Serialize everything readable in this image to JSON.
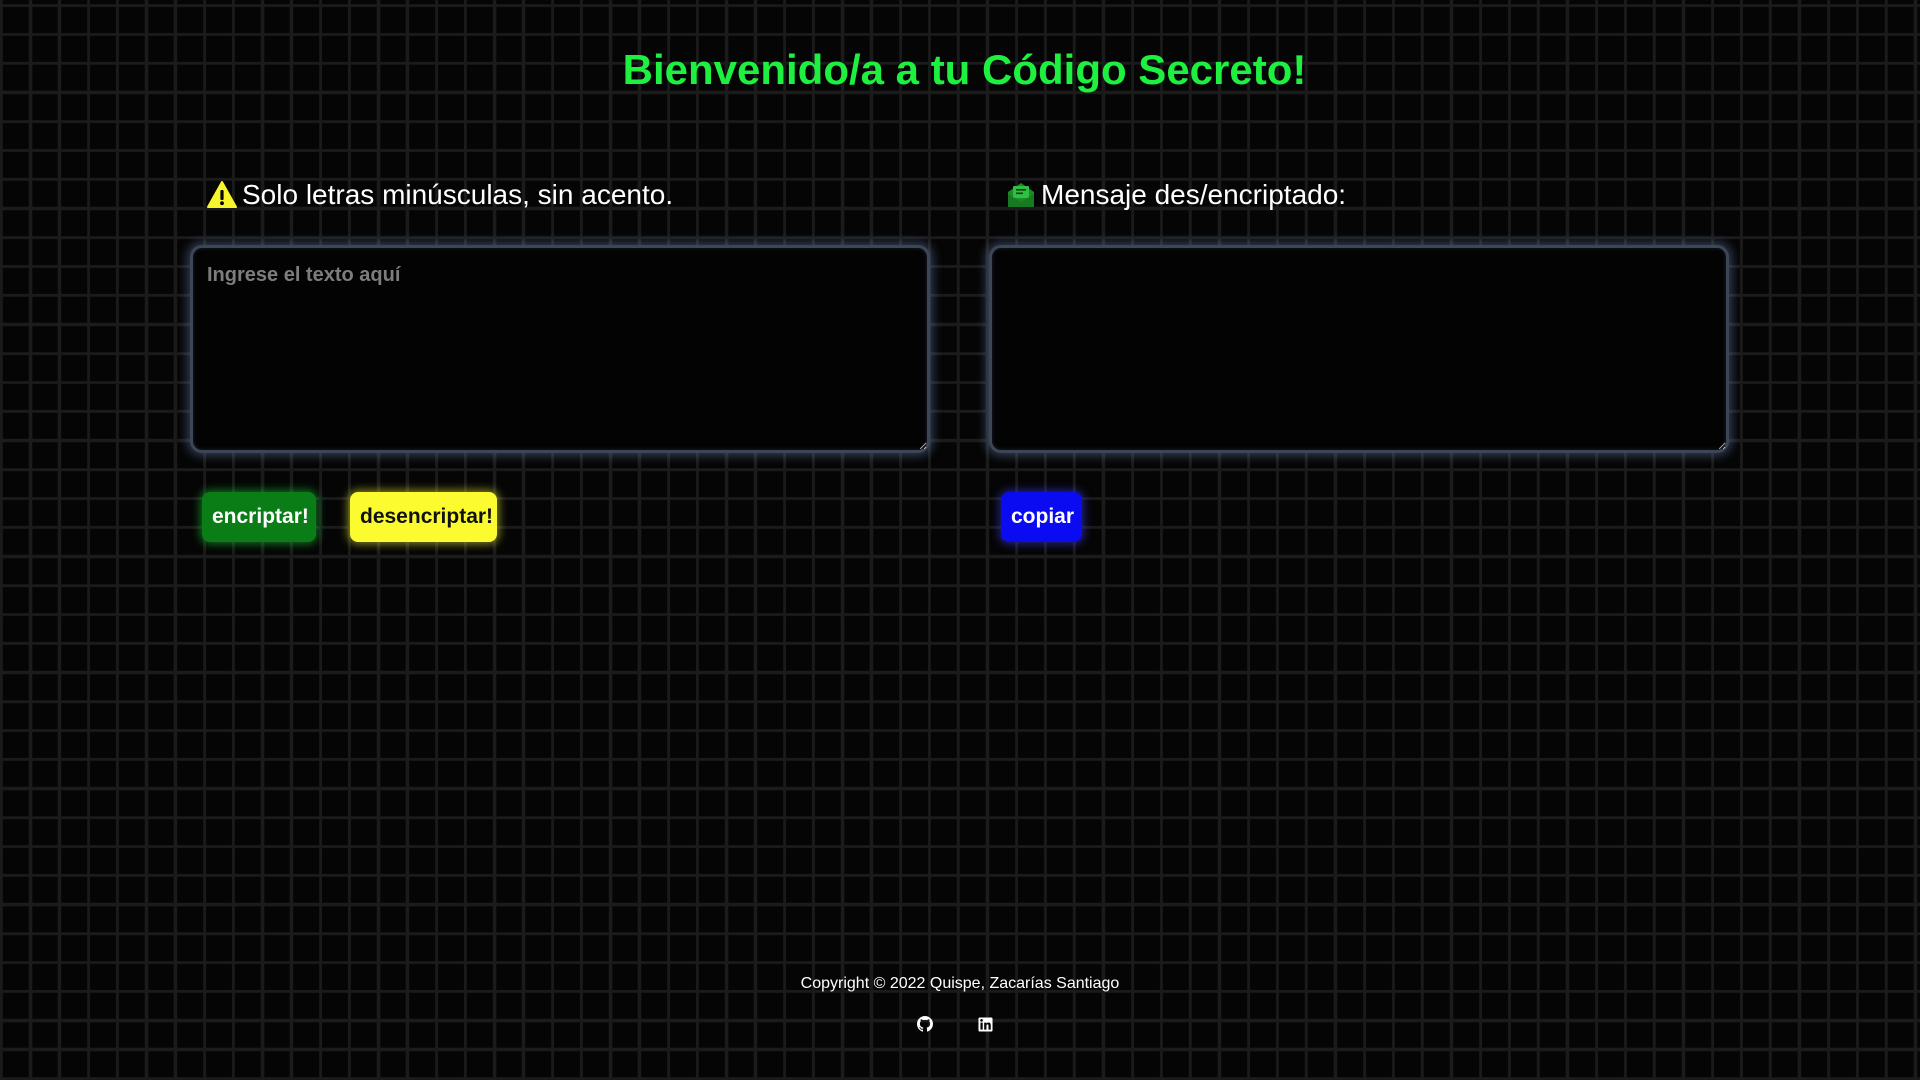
{
  "header": {
    "title": "Bienvenido/a a tu Código Secreto!"
  },
  "input_panel": {
    "heading": "Solo letras minúsculas, sin acento.",
    "heading_icon": "warning-icon",
    "heading_icon_color": "#f6f62a",
    "textarea_value": "",
    "textarea_placeholder": "Ingrese el texto aquí",
    "encrypt_label": "encriptar!",
    "decrypt_label": "desencriptar!"
  },
  "output_panel": {
    "heading": "Mensaje des/encriptado:",
    "heading_icon": "envelope-open-icon",
    "heading_icon_color": "#1d8a2a",
    "textarea_value": "",
    "copy_label": "copiar"
  },
  "footer": {
    "copyright": "Copyright © 2022 Quispe, Zacarías Santiago",
    "social": [
      {
        "name": "github-icon"
      },
      {
        "name": "linkedin-icon"
      }
    ]
  },
  "colors": {
    "title": "#1ef03f",
    "encrypt_button": "#0b7d16",
    "decrypt_button": "#fbfb2f",
    "copy_button": "#0b0bf2",
    "background": "#050505"
  }
}
